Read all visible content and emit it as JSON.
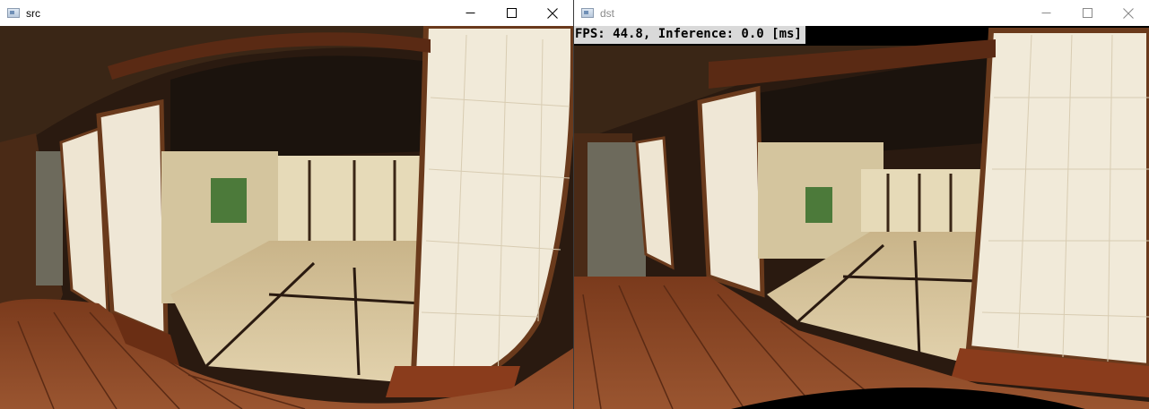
{
  "windows": {
    "src": {
      "title": "src",
      "minimize": "minimize-icon",
      "maximize": "maximize-icon",
      "close": "close-icon"
    },
    "dst": {
      "title": "dst",
      "minimize": "minimize-icon",
      "maximize": "maximize-icon",
      "close": "close-icon",
      "overlay_text": "FPS: 44.8, Inference: 0.0 [ms]"
    }
  },
  "colors": {
    "titlebar": "#ffffff",
    "shoji_paper": "#efe7d6",
    "wood_dark": "#5a2a14",
    "wood_floor": "#8a4524",
    "tatami": "#d8c49a",
    "ceiling": "#1a120c"
  }
}
